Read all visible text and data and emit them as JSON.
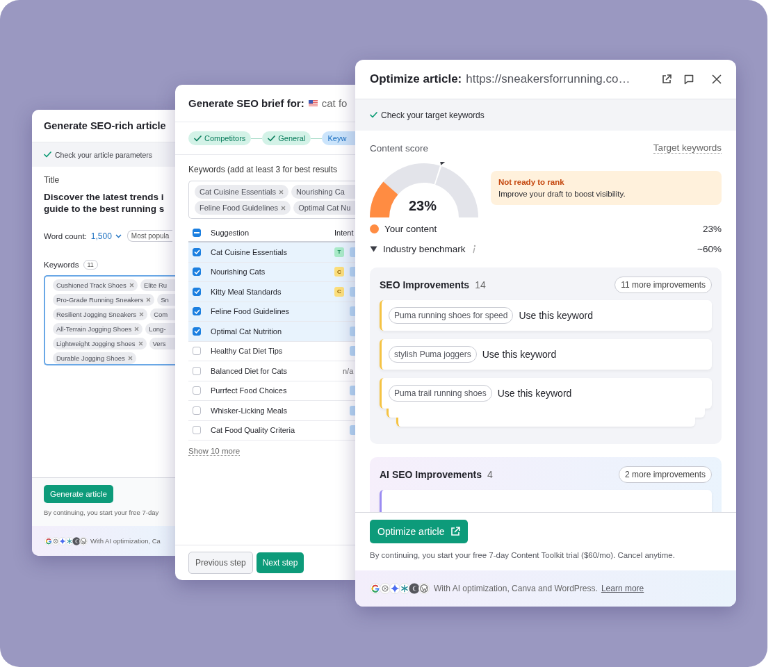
{
  "article_window": {
    "title": "Generate SEO-rich article",
    "status": "Check your article parameters",
    "title_label": "Title",
    "title_lines": [
      "Discover the latest trends i",
      "guide to the best running s"
    ],
    "word_count_label": "Word count:",
    "word_count_value": "1,500",
    "word_count_option": "Most popula",
    "keywords_label": "Keywords",
    "keywords_count": "11",
    "keyword_rows": [
      [
        {
          "text": "Cushioned Track Shoes",
          "kind": "full"
        },
        {
          "text": "Elite Ru",
          "kind": "clipped"
        }
      ],
      [
        {
          "text": "Pro-Grade Running Sneakers",
          "kind": "full"
        },
        {
          "text": "Sn",
          "kind": "clipped"
        }
      ],
      [
        {
          "text": "Resilient Jogging Sneakers",
          "kind": "full"
        },
        {
          "text": "Com",
          "kind": "clipped"
        }
      ],
      [
        {
          "text": "All-Terrain Jogging Shoes",
          "kind": "full"
        },
        {
          "text": "Long-",
          "kind": "clipped"
        }
      ],
      [
        {
          "text": "Lightweight Jogging Shoes",
          "kind": "full"
        },
        {
          "text": "Vers",
          "kind": "clipped"
        }
      ],
      [
        {
          "text": "Durable Jogging Shoes",
          "kind": "full"
        }
      ]
    ],
    "button": "Generate article",
    "disclaimer": "By continuing, you start your free 7-day",
    "integrations": {
      "text": "With AI optimization, Ca"
    }
  },
  "brief_window": {
    "title": "Generate SEO brief for:",
    "query": "cat fo",
    "steps": [
      {
        "label": "Competitors",
        "done": true,
        "selected": false
      },
      {
        "label": "General",
        "done": true,
        "selected": false
      },
      {
        "label": "Keyw",
        "done": false,
        "selected": true
      }
    ],
    "keywords_label": "Keywords (add at least 3 for best results",
    "chip_rows": [
      [
        {
          "text": "Cat Cuisine Essentials",
          "kind": "full"
        },
        {
          "text": "Nourishing Ca",
          "kind": "clipped"
        }
      ],
      [
        {
          "text": "Feline Food Guidelines",
          "kind": "full"
        },
        {
          "text": "Optimal Cat Nu",
          "kind": "clipped"
        }
      ]
    ],
    "table": {
      "select_all_mixed": true,
      "columns": [
        "Suggestion",
        "Intent"
      ],
      "rows": [
        {
          "suggestion": "Cat Cuisine Essentials",
          "checked": true,
          "intents": [
            {
              "kind": "transactional",
              "label": "T"
            },
            {
              "kind": "informational"
            }
          ]
        },
        {
          "suggestion": "Nourishing Cats",
          "checked": true,
          "intents": [
            {
              "kind": "commercial",
              "label": "C"
            },
            {
              "kind": "informational"
            }
          ]
        },
        {
          "suggestion": "Kitty Meal Standards",
          "checked": true,
          "intents": [
            {
              "kind": "commercial",
              "label": "C"
            },
            {
              "kind": "informational"
            }
          ]
        },
        {
          "suggestion": "Feline Food Guidelines",
          "checked": true,
          "intents": [
            {
              "kind": "informational"
            }
          ]
        },
        {
          "suggestion": "Optimal Cat Nutrition",
          "checked": true,
          "intents": [
            {
              "kind": "informational"
            }
          ]
        },
        {
          "suggestion": "Healthy Cat Diet Tips",
          "checked": false,
          "intents": [
            {
              "kind": "informational"
            }
          ]
        },
        {
          "suggestion": "Balanced Diet for Cats",
          "checked": false,
          "intents": [
            {
              "kind": "text",
              "label": "n/a"
            }
          ]
        },
        {
          "suggestion": "Purrfect Food Choices",
          "checked": false,
          "intents": [
            {
              "kind": "informational"
            }
          ]
        },
        {
          "suggestion": "Whisker-Licking Meals",
          "checked": false,
          "intents": [
            {
              "kind": "informational"
            }
          ]
        },
        {
          "suggestion": "Cat Food Quality Criteria",
          "checked": false,
          "intents": [
            {
              "kind": "informational"
            }
          ]
        }
      ]
    },
    "show_more": "Show 10 more",
    "buttons": [
      {
        "label": "Previous step",
        "kind": "secondary"
      },
      {
        "label": "Next step",
        "kind": "primary"
      }
    ]
  },
  "optimize_window": {
    "title": "Optimize article:",
    "url": "https://sneakersforrunning.co…",
    "status": "Check your target keywords",
    "score_label": "Content score",
    "target_link": "Target keywords",
    "gauge": {
      "level": 0.23,
      "reading": "23%",
      "benchmark": {
        "level": 0.6
      }
    },
    "alert": {
      "title": "Not ready to rank",
      "text": "Improve your draft to boost visibility."
    },
    "legend": [
      {
        "kind": "dot",
        "label": "Your content",
        "value": "23%",
        "color": "#ff8c42"
      },
      {
        "kind": "marker",
        "label": "Industry benchmark",
        "value": "~60%",
        "info": true
      }
    ],
    "sections": [
      {
        "kind": "seo",
        "title": "SEO Improvements",
        "count": "14",
        "more": "11 more improvements",
        "stacked": true,
        "items": [
          {
            "keyword": "Puma running shoes for speed",
            "action": "Use this keyword"
          },
          {
            "keyword": "stylish Puma joggers",
            "action": "Use this keyword"
          },
          {
            "keyword": "Puma trail running shoes",
            "action": "Use this keyword"
          }
        ]
      },
      {
        "kind": "ai",
        "title": "AI SEO Improvements",
        "count": "4",
        "more": "2 more improvements",
        "peek": true
      }
    ],
    "button": "Optimize article",
    "disclaimer": "By continuing, you start your free 7-day Content Toolkit trial ($60/mo). Cancel anytime.",
    "integrations": {
      "text": "With AI optimization, Canva and WordPress.",
      "link": "Learn more"
    }
  }
}
